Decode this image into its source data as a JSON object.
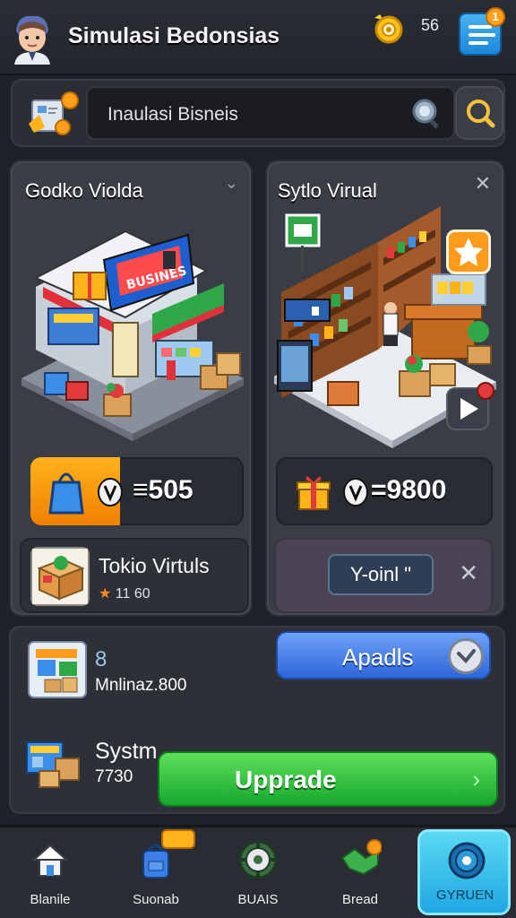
{
  "header": {
    "title": "Simulasi Bedonsias",
    "coin_count": "56",
    "menu_badge": "1",
    "avatar_icon": "player-avatar-icon",
    "coin_icon": "gold-coin-icon"
  },
  "search": {
    "value": "Inaulasi Bisneis",
    "logo_icon": "business-logo-icon",
    "lens_icon": "magnifier-icon",
    "button_icon": "search-icon"
  },
  "cards": [
    {
      "title": "Godko Violda",
      "price": "≡505",
      "price_icon": "shopping-bag-icon",
      "shop_name": "Tokio Virtuls",
      "rating": "11 60",
      "scene": "pixel-storefront"
    },
    {
      "title": "Sytlo Virual",
      "price": "=9800",
      "price_icon": "gift-box-icon",
      "voint_label": "Y-oinl \"",
      "scene": "pixel-shop-interior"
    }
  ],
  "panel": {
    "mini_label": "Mnlinaz.800",
    "mini_sub": "8",
    "apadis_label": "Apadls",
    "system_label": "Systm",
    "system_value": "7730",
    "upgrade_label": "Upprade"
  },
  "nav": [
    {
      "label": "Blanile",
      "icon": "home-icon"
    },
    {
      "label": "Suonab",
      "icon": "backpack-icon"
    },
    {
      "label": "BUAIS",
      "icon": "gear-wheel-icon"
    },
    {
      "label": "Bread",
      "icon": "handshake-icon"
    },
    {
      "label": "GYRUEN",
      "icon": "target-icon"
    }
  ],
  "colors": {
    "accent_orange": "#f07f00",
    "accent_blue": "#2e66d8",
    "accent_green": "#16a72e",
    "active_nav": "#1ea8e2"
  }
}
